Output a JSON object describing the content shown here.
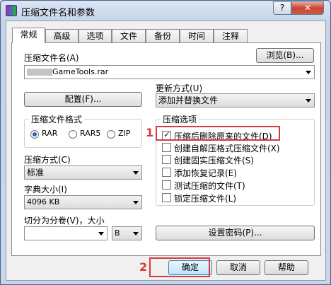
{
  "window": {
    "title": "压缩文件名和参数",
    "help": "?",
    "close": "✕"
  },
  "tabs": [
    "常规",
    "高级",
    "选项",
    "文件",
    "备份",
    "时间",
    "注释"
  ],
  "archive": {
    "label": "压缩文件名(A)",
    "value": "GameTools.rar",
    "browse": "浏览(B)..."
  },
  "profiles": {
    "label": "配置(F)..."
  },
  "update": {
    "label": "更新方式(U)",
    "value": "添加并替换文件"
  },
  "format": {
    "label": "压缩文件格式",
    "options": [
      "RAR",
      "RAR5",
      "ZIP"
    ]
  },
  "options": {
    "label": "压缩选项",
    "items": [
      "压缩后删除原来的文件(D)",
      "创建自解压格式压缩文件(X)",
      "创建固实压缩文件(S)",
      "添加恢复记录(E)",
      "测试压缩的文件(T)",
      "锁定压缩文件(L)"
    ]
  },
  "method": {
    "label": "压缩方式(C)",
    "value": "标准"
  },
  "dictionary": {
    "label": "字典大小(I)",
    "value": "4096 KB"
  },
  "split": {
    "label": "切分为分卷(V)，大小",
    "unit": "B"
  },
  "password": {
    "label": "设置密码(P)..."
  },
  "footer": {
    "ok": "确定",
    "cancel": "取消",
    "help": "帮助"
  },
  "annotations": {
    "one": "1",
    "two": "2"
  }
}
